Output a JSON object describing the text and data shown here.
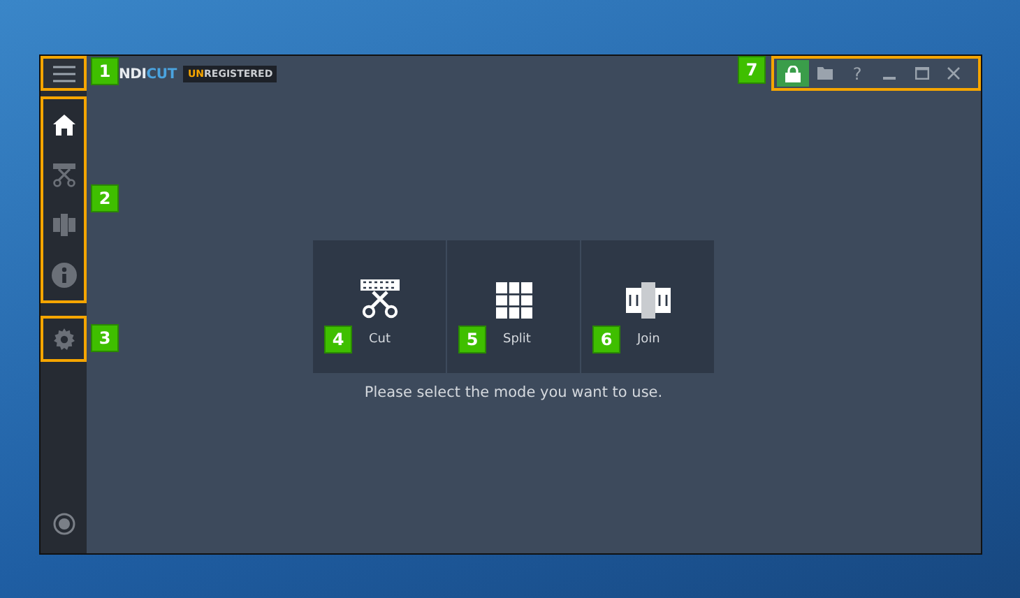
{
  "title_bar": {
    "menu_callout": "1",
    "logo": {
      "part_1": "NDI",
      "part_2": "CUT"
    },
    "status_badge": {
      "part_1": "UN",
      "part_2": "REGISTERED"
    },
    "buttons_callout": "7",
    "buttons": [
      {
        "kind": "lock",
        "on": true
      },
      {
        "kind": "folder",
        "on": false
      },
      {
        "kind": "help",
        "label": "?",
        "on": false
      },
      {
        "kind": "minimize",
        "on": false
      },
      {
        "kind": "maximize",
        "on": false
      },
      {
        "kind": "close",
        "on": false
      }
    ]
  },
  "sidebar": {
    "items_callout": "2",
    "items": [
      {
        "kind": "home",
        "selected": true
      },
      {
        "kind": "cut",
        "selected": false
      },
      {
        "kind": "join",
        "selected": false
      },
      {
        "kind": "info",
        "selected": false
      }
    ],
    "settings_callout": "3"
  },
  "modes": [
    {
      "kind": "cut",
      "label": "Cut",
      "callout": "4"
    },
    {
      "kind": "split",
      "label": "Split",
      "callout": "5"
    },
    {
      "kind": "join",
      "label": "Join",
      "callout": "6"
    }
  ],
  "prompt": "Please select the mode you want to use."
}
